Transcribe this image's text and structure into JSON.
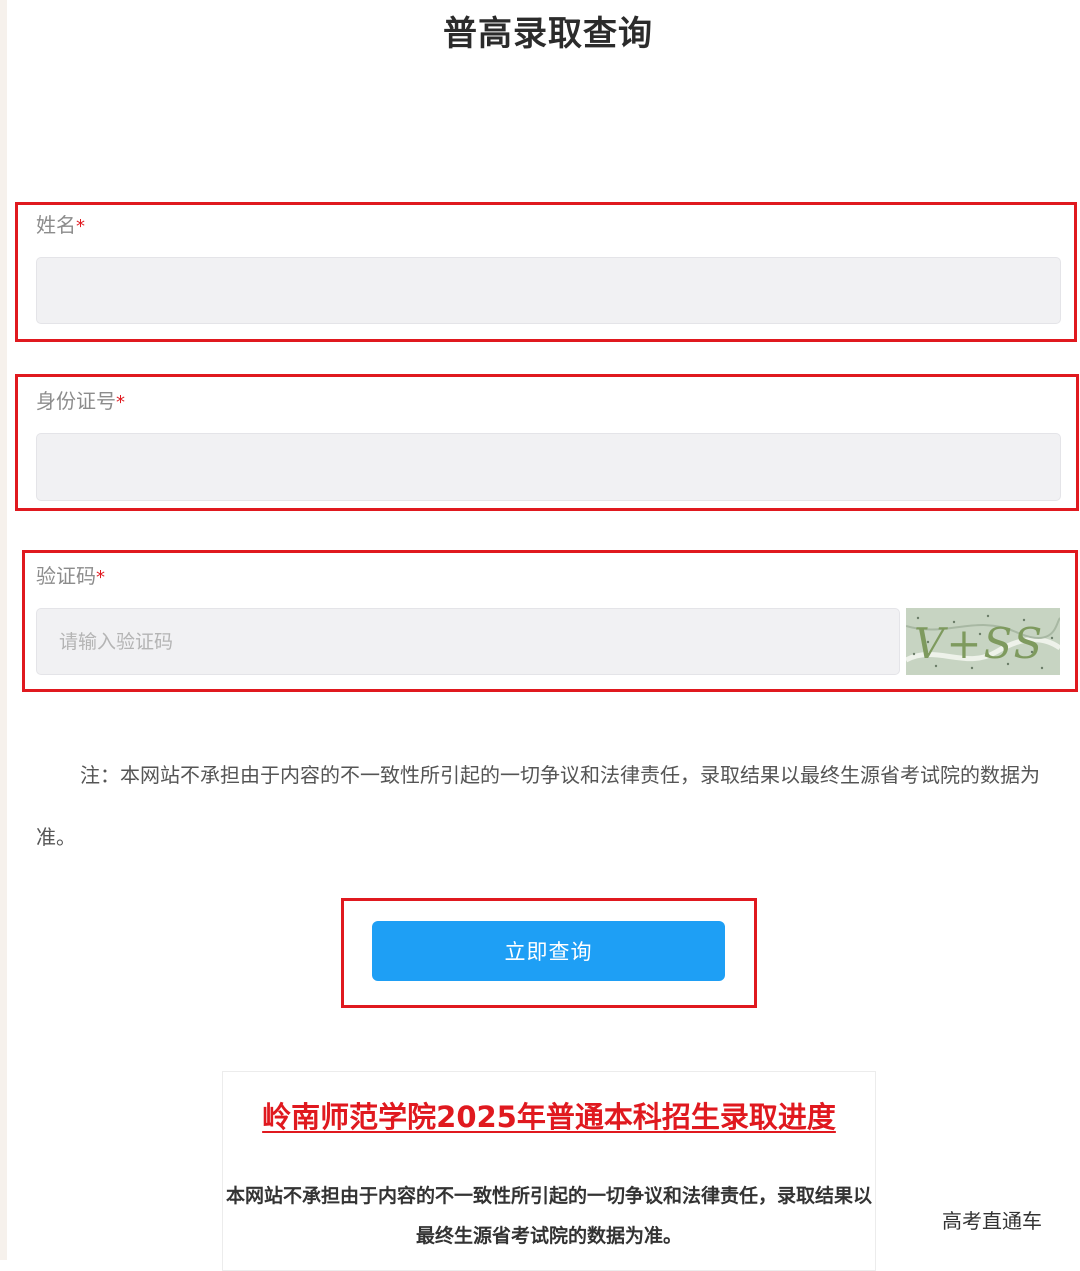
{
  "page": {
    "title": "普高录取查询"
  },
  "form": {
    "name_field": {
      "label": "姓名",
      "required_mark": "*",
      "value": "",
      "placeholder": ""
    },
    "id_field": {
      "label": "身份证号",
      "required_mark": "*",
      "value": "",
      "placeholder": ""
    },
    "captcha_field": {
      "label": "验证码",
      "required_mark": "*",
      "value": "",
      "placeholder": "请输入验证码",
      "captcha_text": "V+SS"
    }
  },
  "note": "注：本网站不承担由于内容的不一致性所引起的一切争议和法律责任，录取结果以最终生源省考试院的数据为准。",
  "submit_button": {
    "label": "立即查询"
  },
  "info_card": {
    "link_text": "岭南师范学院2025年普通本科招生录取进度",
    "disclaimer": "本网站不承担由于内容的不一致性所引起的一切争议和法律责任，录取结果以最终生源省考试院的数据为准。"
  },
  "watermark": "高考直通车",
  "colors": {
    "highlight_border": "#e0191f",
    "required_star": "#e0191f",
    "input_background": "#f1f1f3",
    "button_background": "#1e9ff5",
    "link_color": "#e0191f"
  }
}
